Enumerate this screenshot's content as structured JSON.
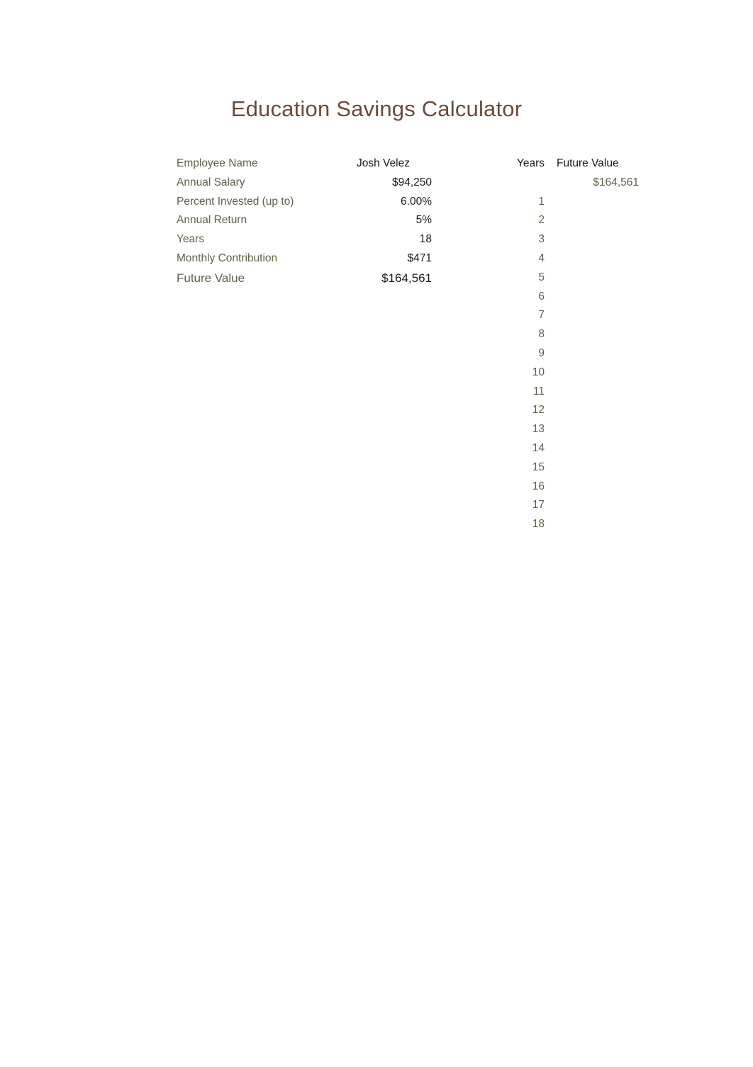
{
  "document": {
    "title": "Education Savings Calculator"
  },
  "parameters": {
    "rows": [
      {
        "label": "Employee Name",
        "value": "Josh Velez",
        "align": "left",
        "emphasis": false
      },
      {
        "label": "Annual Salary",
        "value": "$94,250",
        "align": "right",
        "emphasis": false
      },
      {
        "label": "Percent Invested (up to)",
        "value": "6.00%",
        "align": "right",
        "emphasis": false
      },
      {
        "label": "Annual Return",
        "value": "5%",
        "align": "right",
        "emphasis": false
      },
      {
        "label": "Years",
        "value": "18",
        "align": "right",
        "emphasis": false
      },
      {
        "label": "Monthly Contribution",
        "value": "$471",
        "align": "right",
        "emphasis": false
      },
      {
        "label": "Future Value",
        "value": "$164,561",
        "align": "right",
        "emphasis": true
      }
    ]
  },
  "schedule": {
    "headers": {
      "years": "Years",
      "future_value": "Future Value"
    },
    "total_future_value": "$164,561",
    "rows": [
      {
        "year": "1",
        "future_value": ""
      },
      {
        "year": "2",
        "future_value": ""
      },
      {
        "year": "3",
        "future_value": ""
      },
      {
        "year": "4",
        "future_value": ""
      },
      {
        "year": "5",
        "future_value": ""
      },
      {
        "year": "6",
        "future_value": ""
      },
      {
        "year": "7",
        "future_value": ""
      },
      {
        "year": "8",
        "future_value": ""
      },
      {
        "year": "9",
        "future_value": ""
      },
      {
        "year": "10",
        "future_value": ""
      },
      {
        "year": "11",
        "future_value": ""
      },
      {
        "year": "12",
        "future_value": ""
      },
      {
        "year": "13",
        "future_value": ""
      },
      {
        "year": "14",
        "future_value": ""
      },
      {
        "year": "15",
        "future_value": ""
      },
      {
        "year": "16",
        "future_value": ""
      },
      {
        "year": "17",
        "future_value": ""
      },
      {
        "year": "18",
        "future_value": ""
      }
    ]
  },
  "colors": {
    "title": "#6b4a38",
    "label": "#5c6347",
    "value": "#1a1a1a",
    "background": "#ffffff"
  }
}
